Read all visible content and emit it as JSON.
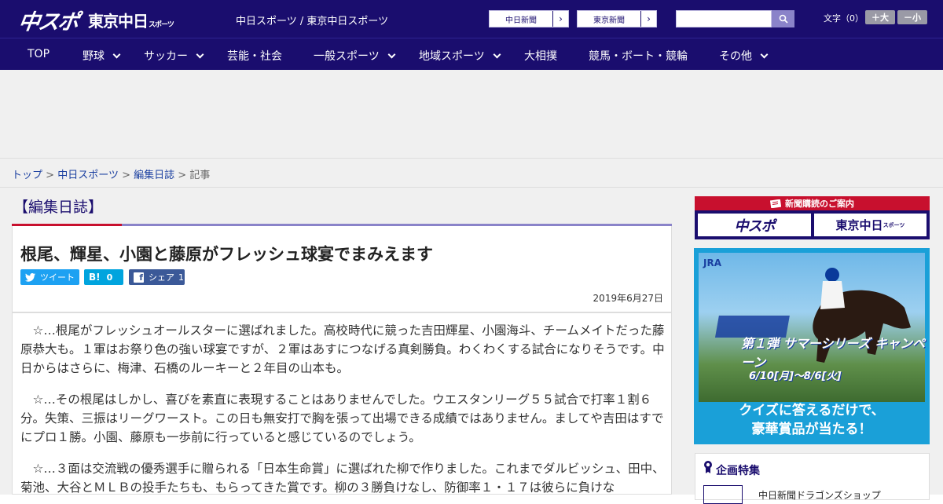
{
  "header": {
    "logo_main": "中スポ",
    "logo_sub": "東京中日",
    "logo_sub_small": "スポーツ",
    "site_links": "中日スポーツ / 東京中日スポーツ",
    "chunichi_link": "中日新聞",
    "tokyo_link": "東京新聞",
    "search_placeholder": "",
    "font_size_label": "文字（0）",
    "font_large": "＋大",
    "font_small": "－小"
  },
  "nav": {
    "items": [
      "TOP",
      "野球",
      "サッカー",
      "芸能・社会",
      "一般スポーツ",
      "地域スポーツ",
      "大相撲",
      "競馬・ボート・競輪",
      "その他"
    ]
  },
  "breadcrumb": {
    "top": "トップ",
    "sep": ">",
    "chunichi": "中日スポーツ",
    "section": "編集日誌",
    "current": "記事"
  },
  "article": {
    "section_title": "【編集日誌】",
    "headline": "根尾、輝星、小園と藤原がフレッシュ球宴でまみえます",
    "tweet_label": "ツイート",
    "hatena_label": "B!",
    "hatena_count": "0",
    "share_label": "シェア",
    "share_count": "1",
    "date": "2019年6月27日",
    "paragraphs": [
      "　☆…根尾がフレッシュオールスターに選ばれました。高校時代に競った吉田輝星、小園海斗、チームメイトだった藤原恭大も。１軍はお祭り色の強い球宴ですが、２軍はあすにつなげる真剣勝負。わくわくする試合になりそうです。中日からはさらに、梅津、石橋のルーキーと２年目の山本も。",
      "　☆…その根尾はしかし、喜びを素直に表現することはありませんでした。ウエスタンリーグ５５試合で打率１割６分。失策、三振はリーグワースト。この日も無安打で胸を張って出場できる成績ではありません。ましてや吉田はすでにプロ１勝。小園、藤原も一歩前に行っていると感じているのでしょう。",
      "　☆…３面は交流戦の優秀選手に贈られる「日本生命賞」に選ばれた柳で作りました。これまでダルビッシュ、田中、菊池、大谷とＭＬＢの投手たちも、もらってきた賞です。柳の３勝負けなし、防御率１・１７は彼らに負けな"
    ]
  },
  "sidebar": {
    "subscribe_title": "新聞購読のご案内",
    "sub_logo1": "中スポ",
    "sub_logo2": "東京中日",
    "sub_logo2_small": "スポーツ",
    "jra_logo": "JRA",
    "jra_campaign1": "第１弾 サマーシリーズ キャンペーン",
    "jra_campaign2": "6/10[月]～8/6[火]",
    "jra_copy1": "クイズに答えるだけで、",
    "jra_copy2": "豪華賞品が当たる！",
    "feature_title": "企画特集",
    "feature_item": "中日新聞ドラゴンズショップ"
  },
  "colors": {
    "brand_navy": "#1a0d6e",
    "accent_red": "#c8102e",
    "twitter": "#1da1f2",
    "hatena": "#00a4de",
    "facebook": "#3b5998"
  }
}
